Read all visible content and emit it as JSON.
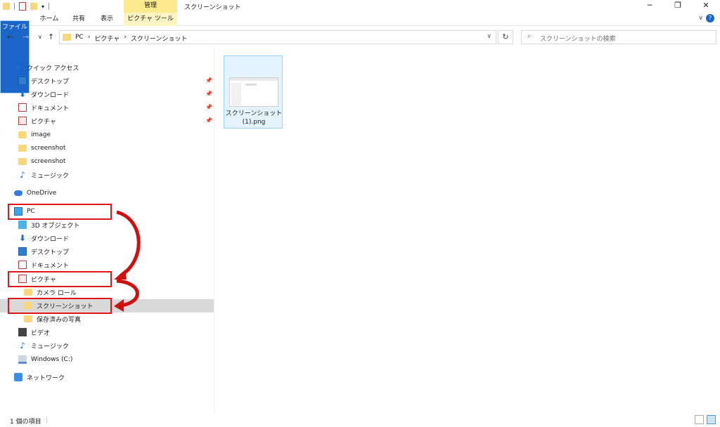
{
  "window": {
    "context_tab": "管理",
    "title": "スクリーンショット",
    "minimize": "─",
    "restore": "❐",
    "close": "✕"
  },
  "ribbon": {
    "tabs": [
      "ファイル",
      "ホーム",
      "共有",
      "表示",
      "ピクチャ ツール"
    ],
    "collapse": "∨",
    "help": "?"
  },
  "nav": {
    "back": "←",
    "forward": "→",
    "recent": "∨",
    "up": "↑",
    "breadcrumb": [
      "PC",
      "›",
      "ピクチャ",
      "›",
      "スクリーンショット"
    ],
    "dropdown": "∨",
    "refresh": "↻",
    "search_icon": "⌕",
    "search_placeholder": "スクリーンショットの検索"
  },
  "sidebar": {
    "quick_access": "クイック アクセス",
    "quick_items": [
      "デスクトップ",
      "ダウンロード",
      "ドキュメント",
      "ピクチャ",
      "image",
      "screenshot",
      "screenshot",
      "ミュージック"
    ],
    "onedrive": "OneDrive",
    "pc": "PC",
    "pc_items": [
      "3D オブジェクト",
      "ダウンロード",
      "デスクトップ",
      "ドキュメント",
      "ピクチャ"
    ],
    "picture_children": [
      "カメラ ロール",
      "スクリーンショット",
      "保存済みの写真"
    ],
    "pc_items_after": [
      "ビデオ",
      "ミュージック",
      "Windows (C:)"
    ],
    "network": "ネットワーク",
    "pin_glyph": "📌"
  },
  "files": [
    {
      "name_line1": "スクリーンショット",
      "name_line2": "(1).png"
    }
  ],
  "status": {
    "item_count": "1 個の項目"
  },
  "colors": {
    "accent": "#1a65c7",
    "highlight_box": "#e0161f",
    "arrow": "#d01010",
    "selection": "#d9d9d9"
  }
}
